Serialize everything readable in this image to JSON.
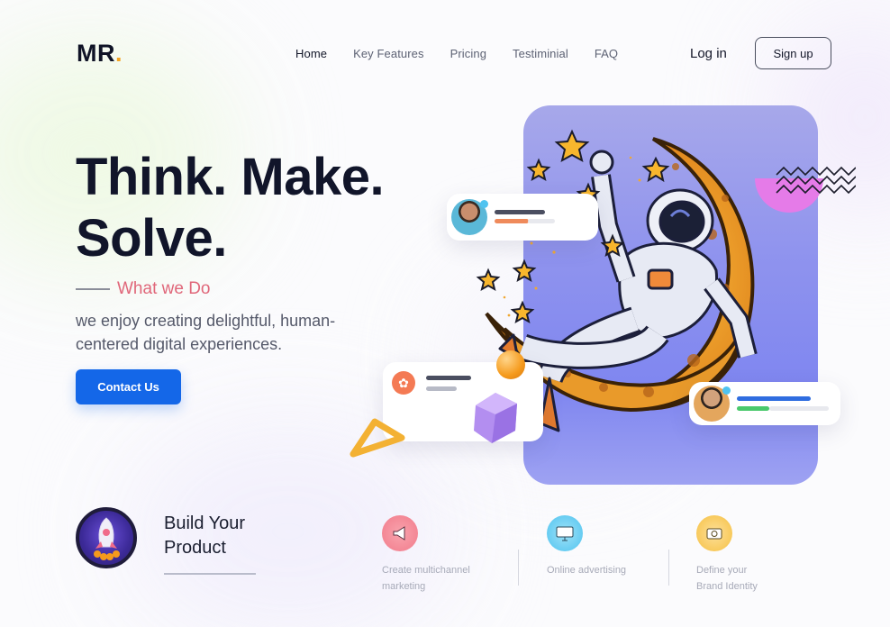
{
  "brand": {
    "logo_text": "MR",
    "logo_dot": ".",
    "accent": "#f4a321"
  },
  "nav": {
    "items": [
      {
        "label": "Home"
      },
      {
        "label": "Key Features"
      },
      {
        "label": "Pricing"
      },
      {
        "label": "Testiminial"
      },
      {
        "label": "FAQ"
      }
    ],
    "active_index": 0
  },
  "auth": {
    "login_label": "Log in",
    "signup_label": "Sign up"
  },
  "hero": {
    "headline_line1": "Think. Make.",
    "headline_line2": "Solve.",
    "tagline": "What we Do",
    "description": "we enjoy creating delightful, human-centered digital experiences.",
    "cta_label": "Contact Us",
    "cta_color": "#1467e8",
    "tagline_color": "#e0677a"
  },
  "illustration": {
    "subject": "astronaut-on-moon",
    "panel_color": "#8f93ee"
  },
  "bottom": {
    "badge_icon": "rocket-icon",
    "title_line1": "Build Your",
    "title_line2": "Product",
    "features": [
      {
        "icon": "megaphone-icon",
        "label_line1": "Create multichannel",
        "label_line2": "marketing",
        "color": "#f27b8b"
      },
      {
        "icon": "monitor-icon",
        "label_line1": "Online advertising",
        "label_line2": "",
        "color": "#4fc3f0"
      },
      {
        "icon": "brand-icon",
        "label_line1": "Define your",
        "label_line2": "Brand Identity",
        "color": "#f6c042"
      }
    ]
  }
}
